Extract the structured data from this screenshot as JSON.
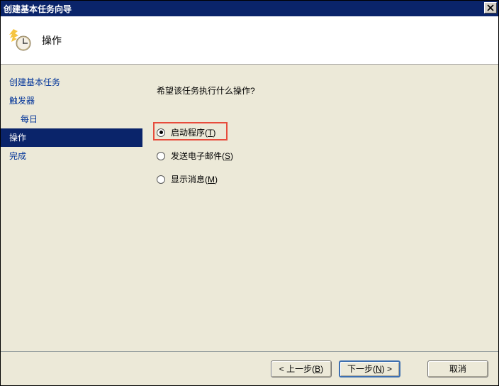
{
  "window": {
    "title": "创建基本任务向导"
  },
  "header": {
    "title": "操作"
  },
  "sidebar": {
    "items": [
      {
        "label": "创建基本任务",
        "indent": false,
        "selected": false
      },
      {
        "label": "触发器",
        "indent": false,
        "selected": false
      },
      {
        "label": "每日",
        "indent": true,
        "selected": false
      },
      {
        "label": "操作",
        "indent": false,
        "selected": true
      },
      {
        "label": "完成",
        "indent": false,
        "selected": false
      }
    ]
  },
  "main": {
    "prompt": "希望该任务执行什么操作?",
    "radios": [
      {
        "label": "启动程序",
        "accel": "T",
        "checked": true,
        "highlight": true
      },
      {
        "label": "发送电子邮件",
        "accel": "S",
        "checked": false,
        "highlight": false
      },
      {
        "label": "显示消息",
        "accel": "M",
        "checked": false,
        "highlight": false
      }
    ]
  },
  "footer": {
    "back": {
      "pre": "< 上一步(",
      "accel": "B",
      "post": ")"
    },
    "next": {
      "pre": "下一步(",
      "accel": "N",
      "post": ") >"
    },
    "cancel": "取消"
  }
}
